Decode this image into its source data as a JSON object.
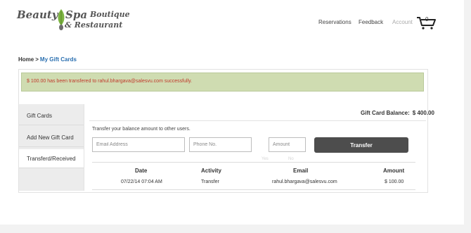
{
  "brand": {
    "line1_a": "Beauty",
    "line1_b": "Spa",
    "line1_c": "Boutique",
    "line2": "& Restaurant",
    "leaf_color": "#7cb342"
  },
  "nav": {
    "reservations": "Reservations",
    "feedback": "Feedback",
    "account": "Account",
    "cart_count": "0",
    "cart_icon": "shopping-cart-icon"
  },
  "breadcrumb": {
    "home": "Home",
    "separator": ">",
    "current": "My Gift Cards"
  },
  "alert": {
    "message": "$ 100.00 has been transfered to rahul.bhargava@salesvu.com successfully.",
    "background": "#cfdcb1",
    "text_color": "#c0392b"
  },
  "sidebar": {
    "items": [
      {
        "label": "Gift Cards"
      },
      {
        "label": "Add New Gift Card"
      },
      {
        "label": "Transferd/Received",
        "active": true
      }
    ]
  },
  "balance": {
    "label": "Gift Card Balance:",
    "amount": "$ 400.00"
  },
  "transfer": {
    "hint": "Transfer your balance amount to other users.",
    "email_placeholder": "Email Address",
    "phone_placeholder": "Phone No.",
    "amount_placeholder": "Amount",
    "button_label": "Transfer",
    "faint_labels": [
      "Yes",
      "No"
    ]
  },
  "table": {
    "headers": {
      "date": "Date",
      "activity": "Activity",
      "email": "Email",
      "amount": "Amount"
    },
    "rows": [
      {
        "date": "07/22/14 07:04 AM",
        "activity": "Transfer",
        "email": "rahul.bhargava@salesvu.com",
        "amount": "$ 100.00"
      }
    ]
  }
}
